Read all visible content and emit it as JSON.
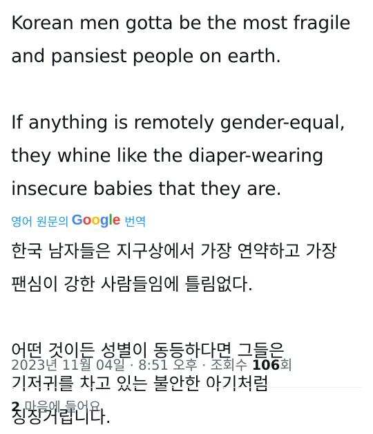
{
  "post": {
    "english": {
      "p1_line1": "Korean men gotta be the most fragile",
      "p1_line2": "and pansiest people on earth.",
      "p2_line1": "If anything is remotely gender-equal,",
      "p2_line2": "they whine like the diaper-wearing",
      "p2_line3": "insecure babies that they are."
    },
    "translation_label_prefix": "영어 원문의",
    "translation_brand": {
      "G": "G",
      "o1": "o",
      "o2": "o",
      "g": "g",
      "l": "l",
      "e": "e"
    },
    "translation_label_suffix": "번역",
    "korean": {
      "p1_line1": "한국 남자들은 지구상에서 가장 연약하고 가장",
      "p1_line2": "팬심이 강한 사람들임에 틀림없다.",
      "p2_line1": "어떤 것이든 성별이 동등하다면 그들은",
      "p2_line2": "기저귀를 차고 있는 불안한 아기처럼",
      "p2_line3": "징징거립니다."
    }
  },
  "meta": {
    "date": "2023년 11월 04일",
    "separator1": " · ",
    "time": "8:51 오후",
    "separator2": " · ",
    "views_label": "조회수 ",
    "views_count": "106",
    "views_suffix": "회"
  },
  "likes": {
    "count": "2",
    "label": "마음에 들어요"
  },
  "colors": {
    "text": "#0f1419",
    "secondary": "#536471",
    "link": "#1d9bf0",
    "divider": "#eff3f4"
  }
}
